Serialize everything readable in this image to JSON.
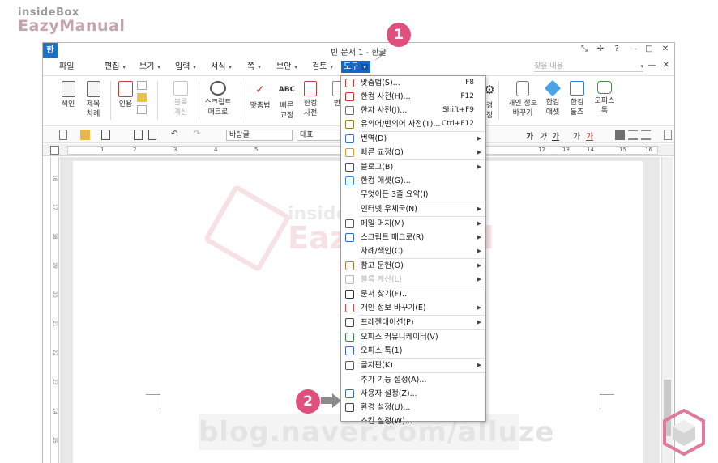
{
  "watermark": {
    "brand_small": "insideBox",
    "brand_big": "EazyManual",
    "center_small": "insideBox",
    "center_big": "EazyManual",
    "url": "blog.naver.com/alluze"
  },
  "window": {
    "title": "빈 문서 1 - 한글",
    "logo": "한",
    "controls": [
      "expand-icon",
      "pin-icon",
      "help-icon",
      "minimize-icon",
      "maximize-icon",
      "close-icon"
    ],
    "controls_glyphs": [
      "⤡",
      "✢",
      "?",
      "—",
      "□",
      "✕"
    ]
  },
  "menubar": {
    "items": [
      "파일",
      "편집",
      "보기",
      "입력",
      "서식",
      "쪽",
      "보안",
      "검토",
      "도구"
    ],
    "active": "도구",
    "search_placeholder": "찾을 내용"
  },
  "ribbon": {
    "buttons": [
      {
        "label1": "색인",
        "label2": "",
        "enabled": true
      },
      {
        "label1": "제목",
        "label2": "차례",
        "enabled": true
      },
      {
        "label1": "인용",
        "label2": "",
        "enabled": true
      },
      {
        "label1": "블록",
        "label2": "계산",
        "enabled": false
      },
      {
        "label1": "스크립트",
        "label2": "매크로",
        "enabled": true
      },
      {
        "label1": "맞춤법",
        "label2": "",
        "enabled": true
      },
      {
        "label1": "빠른",
        "label2": "교정",
        "enabled": true
      },
      {
        "label1": "한컴",
        "label2": "사전",
        "enabled": true
      },
      {
        "label1": "번",
        "label2": "",
        "enabled": true
      },
      {
        "label1": "경",
        "label2": "정",
        "enabled": true
      },
      {
        "label1": "개인 정보",
        "label2": "바꾸기",
        "enabled": true
      },
      {
        "label1": "한컴",
        "label2": "애셋",
        "enabled": true
      },
      {
        "label1": "한컴",
        "label2": "툴즈",
        "enabled": true
      },
      {
        "label1": "오피스",
        "label2": "톡",
        "enabled": true
      }
    ]
  },
  "toolbar": {
    "style_value": "바탕글",
    "font_value": "대표",
    "format_glyphs": [
      "가",
      "가",
      "가",
      "가",
      "가"
    ]
  },
  "ruler": {
    "marks": [
      "1",
      "2",
      "3",
      "4",
      "5",
      "12",
      "13",
      "14",
      "15",
      "16"
    ]
  },
  "vruler": {
    "marks": [
      "16",
      "17",
      "18",
      "19",
      "20",
      "21",
      "22",
      "23",
      "24",
      "25"
    ]
  },
  "dropdown": {
    "items": [
      {
        "label": "맞춤법(S)...",
        "shortcut": "F8",
        "submenu": false,
        "disabled": false,
        "icon": "spellcheck-icon",
        "color": "#d23b3b"
      },
      {
        "label": "한컴 사전(H)...",
        "shortcut": "F12",
        "submenu": false,
        "disabled": false,
        "icon": "dictionary-icon",
        "color": "#c0392b"
      },
      {
        "label": "한자 사전(J)...",
        "shortcut": "Shift+F9",
        "submenu": false,
        "disabled": false,
        "icon": "hanja-dictionary-icon",
        "color": "#6b6b6b"
      },
      {
        "label": "유의어/반의어 사전(T)...",
        "shortcut": "Ctrl+F12",
        "submenu": false,
        "disabled": false,
        "icon": "thesaurus-icon",
        "color": "#a07c2e"
      },
      {
        "label": "번역(D)",
        "shortcut": "",
        "submenu": true,
        "disabled": false,
        "icon": "translate-icon",
        "color": "#3b74c4",
        "sep_before": true
      },
      {
        "label": "빠른 교정(Q)",
        "shortcut": "",
        "submenu": true,
        "disabled": false,
        "icon": "quick-correct-icon",
        "color": "#e39b1d"
      },
      {
        "label": "블로그(B)",
        "shortcut": "",
        "submenu": true,
        "disabled": false,
        "icon": "blog-icon",
        "color": "#4a4a4a",
        "sep_before": true
      },
      {
        "label": "한컴 애셋(G)...",
        "shortcut": "",
        "submenu": false,
        "disabled": false,
        "icon": "asset-icon",
        "color": "#3a8fd6"
      },
      {
        "label": "무엇이든 3줄 요약(I)",
        "shortcut": "",
        "submenu": false,
        "disabled": false,
        "icon": "",
        "color": ""
      },
      {
        "label": "인터넷 우체국(N)",
        "shortcut": "",
        "submenu": true,
        "disabled": false,
        "icon": "",
        "color": "",
        "sep_before": true
      },
      {
        "label": "메일 머지(M)",
        "shortcut": "",
        "submenu": true,
        "disabled": false,
        "icon": "mail-merge-icon",
        "color": "#555555",
        "sep_before": true
      },
      {
        "label": "스크립트 매크로(R)",
        "shortcut": "",
        "submenu": true,
        "disabled": false,
        "icon": "script-macro-icon",
        "color": "#2a6fbe"
      },
      {
        "label": "차례/색인(C)",
        "shortcut": "",
        "submenu": true,
        "disabled": false,
        "icon": "",
        "color": ""
      },
      {
        "label": "참고 문헌(O)",
        "shortcut": "",
        "submenu": true,
        "disabled": false,
        "icon": "reference-icon",
        "color": "#c27d2a",
        "sep_before": true
      },
      {
        "label": "블록 계산(L)",
        "shortcut": "",
        "submenu": true,
        "disabled": true,
        "icon": "block-calc-icon",
        "color": "#bbbbbb"
      },
      {
        "label": "문서 찾기(F)...",
        "shortcut": "",
        "submenu": false,
        "disabled": false,
        "icon": "binoculars-icon",
        "color": "#333333",
        "sep_before": true
      },
      {
        "label": "개인 정보 바꾸기(E)",
        "shortcut": "",
        "submenu": true,
        "disabled": false,
        "icon": "privacy-icon",
        "color": "#d14a4a"
      },
      {
        "label": "프레젠테이션(P)",
        "shortcut": "",
        "submenu": true,
        "disabled": false,
        "icon": "presentation-icon",
        "color": "#444444",
        "sep_before": true
      },
      {
        "label": "오피스 커뮤니케이터(V)",
        "shortcut": "",
        "submenu": false,
        "disabled": false,
        "icon": "communicator-icon",
        "color": "#2d8f4e",
        "sep_before": true
      },
      {
        "label": "오피스 톡(1)",
        "shortcut": "",
        "submenu": false,
        "disabled": false,
        "icon": "office-talk-icon",
        "color": "#3b6ab8"
      },
      {
        "label": "글자판(K)",
        "shortcut": "",
        "submenu": true,
        "disabled": false,
        "icon": "keyboard-icon",
        "color": "#555555",
        "sep_before": true
      },
      {
        "label": "추가 기능 설정(A)...",
        "shortcut": "",
        "submenu": false,
        "disabled": false,
        "icon": "",
        "color": "",
        "sep_before": true
      },
      {
        "label": "사용자 설정(Z)...",
        "shortcut": "",
        "submenu": false,
        "disabled": false,
        "icon": "user-settings-icon",
        "color": "#3a6fb5"
      },
      {
        "label": "환경 설정(U)...",
        "shortcut": "",
        "submenu": false,
        "disabled": false,
        "icon": "gear-icon",
        "color": "#444444"
      },
      {
        "label": "스킨 설정(W)...",
        "shortcut": "",
        "submenu": false,
        "disabled": false,
        "icon": "",
        "color": ""
      }
    ]
  },
  "callouts": {
    "step1": "1",
    "step2": "2"
  },
  "colors": {
    "accent": "#1767c9",
    "badge": "#e0507d"
  }
}
